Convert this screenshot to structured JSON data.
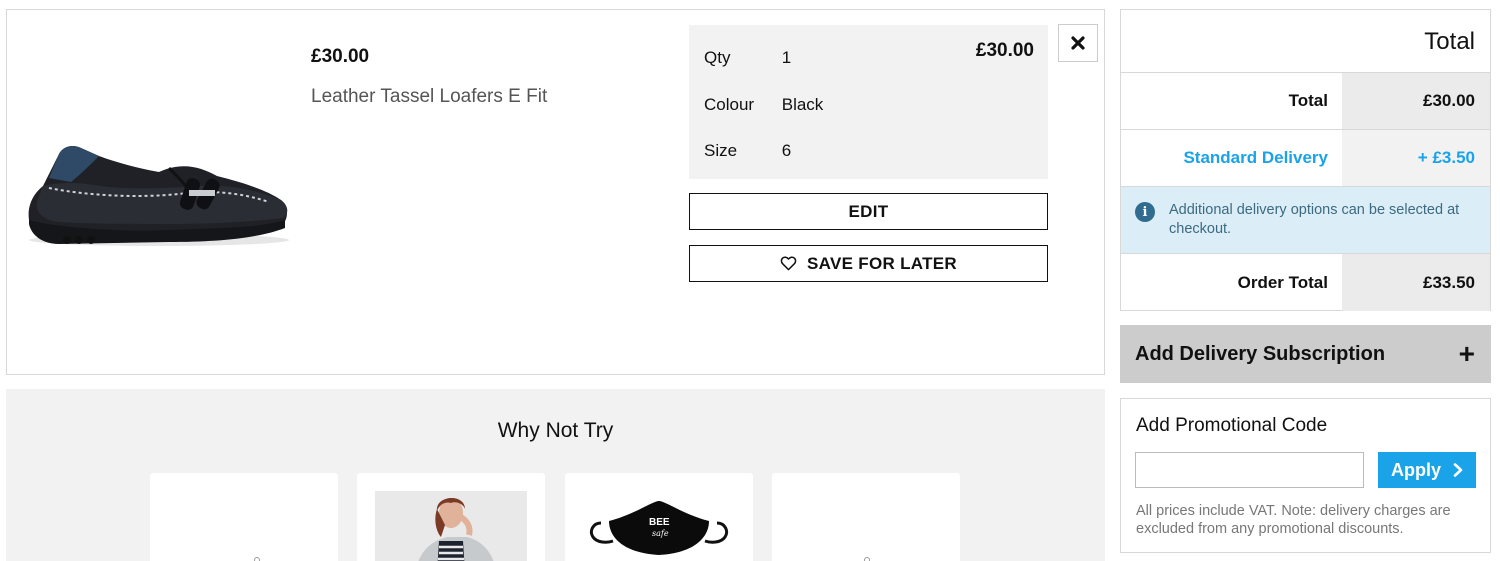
{
  "product": {
    "price": "£30.00",
    "name": "Leather Tassel Loafers E Fit",
    "image_icon": "loafer-shoe-image",
    "options": [
      {
        "label": "Qty",
        "value": "1"
      },
      {
        "label": "Colour",
        "value": "Black"
      },
      {
        "label": "Size",
        "value": "6"
      }
    ],
    "line_total": "£30.00",
    "edit_label": "EDIT",
    "save_label": "SAVE FOR LATER",
    "remove_icon": "close-icon"
  },
  "why_not_try": {
    "title": "Why Not Try",
    "cards": [
      {
        "name": "recommendation-card-1"
      },
      {
        "name": "recommendation-card-2"
      },
      {
        "name": "recommendation-card-3",
        "mask_text_1": "BEE",
        "mask_text_2": "safe"
      },
      {
        "name": "recommendation-card-4"
      }
    ]
  },
  "totals": {
    "heading": "Total",
    "total_label": "Total",
    "total_value": "£30.00",
    "delivery_label": "Standard Delivery",
    "delivery_value": "+ £3.50",
    "info_text": "Additional delivery options can be selected at checkout.",
    "order_total_label": "Order Total",
    "order_total_value": "£33.50"
  },
  "subscription": {
    "label": "Add Delivery Subscription",
    "icon": "+"
  },
  "promo": {
    "title": "Add Promotional Code",
    "input_value": "",
    "apply_label": "Apply",
    "note": "All prices include VAT. Note: delivery charges are excluded from any promotional discounts."
  },
  "colors": {
    "accent": "#1aa3e8",
    "panel_grey": "#f2f2f2",
    "info_bg": "#dbeef7"
  }
}
